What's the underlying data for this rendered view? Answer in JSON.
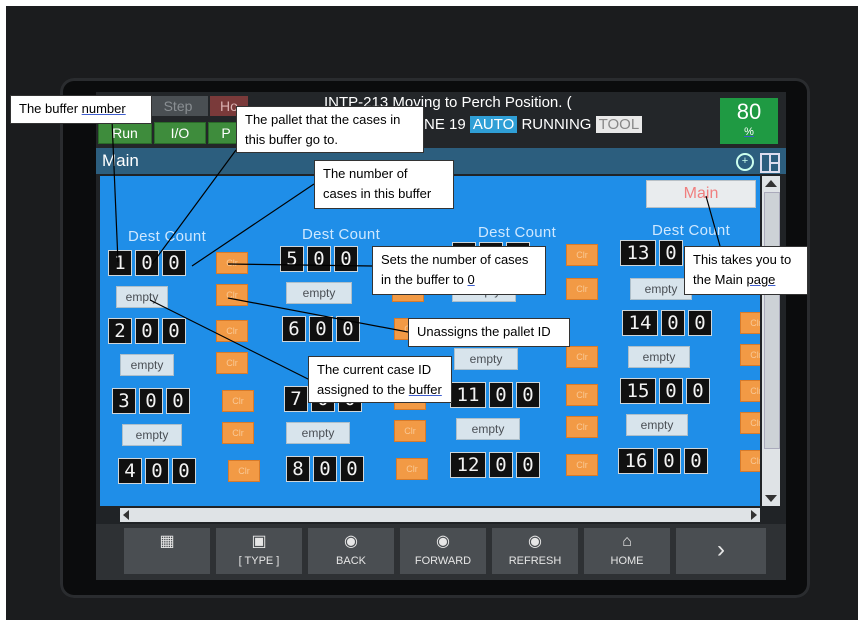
{
  "status_bar": {
    "run": "Run",
    "io": "I/O",
    "p_btn": "P",
    "step": "Step",
    "ho": "Ho",
    "message": "INTP-213 Moving to Perch Position.   (",
    "line2_prefix": "NE 19",
    "auto": "AUTO",
    "running": "RUNNING",
    "tool": "TOOL",
    "percent": "80",
    "percent_unit": "%"
  },
  "title": "Main",
  "main_button": "Main",
  "dest_count_label": "Dest Count",
  "clr_label": "Clr",
  "empty_label": "empty",
  "buffers": {
    "c1": [
      [
        "1",
        "0",
        "0"
      ],
      [
        "2",
        "0",
        "0"
      ],
      [
        "3",
        "0",
        "0"
      ],
      [
        "4",
        "0",
        "0"
      ]
    ],
    "c2": [
      [
        "5",
        "0",
        "0"
      ],
      [
        "6",
        "0",
        "0"
      ],
      [
        "7",
        "0",
        "0"
      ],
      [
        "8",
        "0",
        "0"
      ]
    ],
    "c3": [
      [
        "",
        "",
        ""
      ],
      [
        "",
        "",
        ""
      ],
      [
        "11",
        "0",
        "0"
      ],
      [
        "12",
        "0",
        "0"
      ]
    ],
    "c4": [
      [
        "13",
        "0",
        ""
      ],
      [
        "14",
        "0",
        "0"
      ],
      [
        "15",
        "0",
        "0"
      ],
      [
        "16",
        "0",
        "0"
      ]
    ]
  },
  "nav": {
    "type": "[ TYPE ]",
    "back": "BACK",
    "forward": "FORWARD",
    "refresh": "REFRESH",
    "home": "HOME"
  },
  "annotations": {
    "buffer_number_prefix": "The buffer ",
    "buffer_number_word": "number",
    "pallet": "The pallet that the cases in this buffer go to.",
    "cases_count": "The number of cases in this buffer",
    "sets_cases_prefix": "Sets the number of cases in the buffer to ",
    "sets_cases_zero": "0",
    "unassign": "Unassigns the pallet ID",
    "case_id_prefix": "The current case ID assigned to the ",
    "case_id_word": "buffer",
    "main_page_prefix": "This takes you to the Main ",
    "main_page_word": "page"
  },
  "colors": {
    "content_blue": "#1f8ee8",
    "clr_orange": "#f29a45",
    "status_green": "#1f9a43",
    "auto_blue": "#2f9fd6"
  }
}
